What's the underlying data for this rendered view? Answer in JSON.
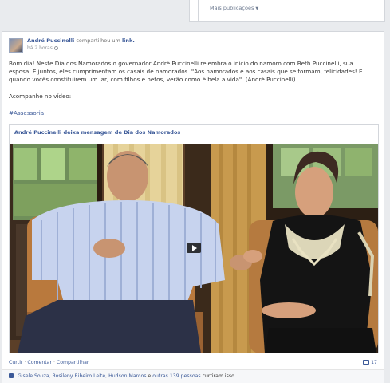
{
  "top_card": {
    "more_publications": "Mais publicações"
  },
  "post": {
    "author": "André Puccinelli",
    "shared_text": "compartilhou um",
    "shared_link": "link.",
    "timestamp": "há 2 horas",
    "body": [
      "Bom dia! Neste Dia dos Namorados o governador André Puccinelli relembra o início do namoro com Beth Puccinelli, sua esposa. E juntos, eles cumprimentam os casais de namorados. \"Aos namorados e aos casais que se formam, felicidades! E quando vocês constituirem um lar, com filhos e netos, verão como é bela a vida\". (André Puccinelli)",
      "Acompanhe no vídeo:",
      "#Assessoria"
    ],
    "link_title": "André Puccinelli deixa mensagem de Dia dos Namorados",
    "actions": {
      "like": "Curtir",
      "comment": "Comentar",
      "share": "Compartilhar",
      "separator": "·"
    },
    "share_count": "17",
    "likes": {
      "names": "Gisele Souza, Rosileny Ribeiro Leite, Hudson Marcos",
      "others_connector": "e",
      "others": "outras 139 pessoas",
      "suffix": "curtiram isso."
    }
  }
}
